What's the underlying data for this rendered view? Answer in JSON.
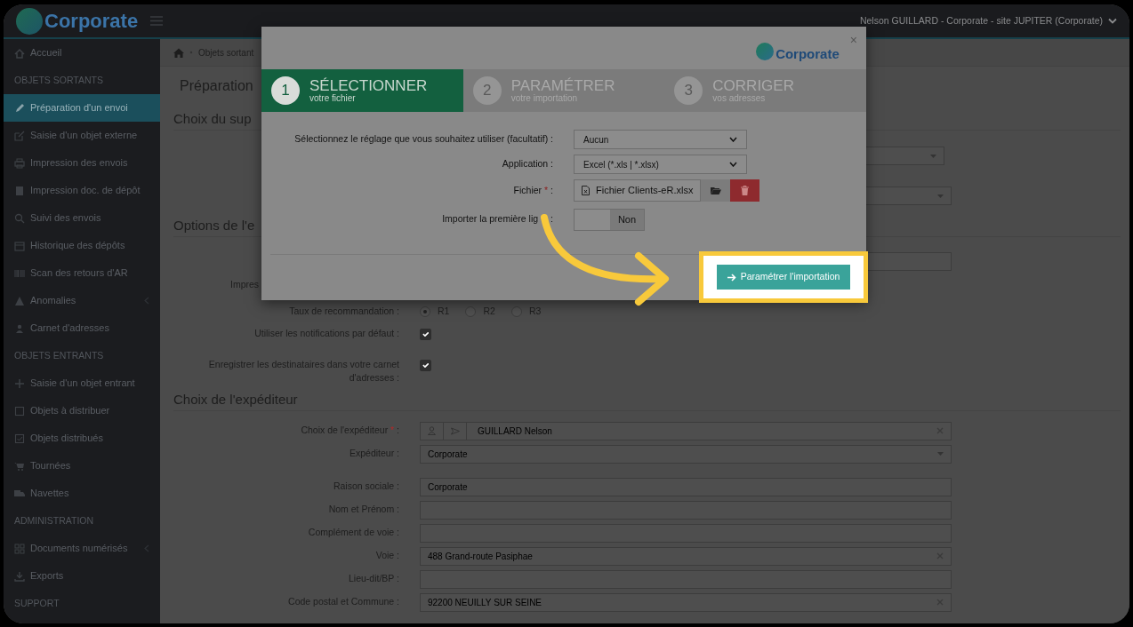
{
  "navbar": {
    "brand": "Corporate",
    "user": "Nelson GUILLARD - Corporate - site JUPITER (Corporate)"
  },
  "sidebar": {
    "items": [
      {
        "kind": "link",
        "label": "Accueil",
        "selected": false,
        "expandable": false
      },
      {
        "kind": "section",
        "label": "OBJETS SORTANTS"
      },
      {
        "kind": "link",
        "label": "Préparation d'un envoi",
        "selected": true,
        "expandable": false
      },
      {
        "kind": "link",
        "label": "Saisie d'un objet externe",
        "selected": false,
        "expandable": false
      },
      {
        "kind": "link",
        "label": "Impression des envois",
        "selected": false,
        "expandable": false
      },
      {
        "kind": "link",
        "label": "Impression doc. de dépôt",
        "selected": false,
        "expandable": false
      },
      {
        "kind": "link",
        "label": "Suivi des envois",
        "selected": false,
        "expandable": false
      },
      {
        "kind": "link",
        "label": "Historique des dépôts",
        "selected": false,
        "expandable": false
      },
      {
        "kind": "link",
        "label": "Scan des retours d'AR",
        "selected": false,
        "expandable": false
      },
      {
        "kind": "link",
        "label": "Anomalies",
        "selected": false,
        "expandable": true
      },
      {
        "kind": "link",
        "label": "Carnet d'adresses",
        "selected": false,
        "expandable": false
      },
      {
        "kind": "section",
        "label": "OBJETS ENTRANTS"
      },
      {
        "kind": "link",
        "label": "Saisie d'un objet entrant",
        "selected": false,
        "expandable": false
      },
      {
        "kind": "link",
        "label": "Objets à distribuer",
        "selected": false,
        "expandable": false
      },
      {
        "kind": "link",
        "label": "Objets distribués",
        "selected": false,
        "expandable": false
      },
      {
        "kind": "link",
        "label": "Tournées",
        "selected": false,
        "expandable": false
      },
      {
        "kind": "link",
        "label": "Navettes",
        "selected": false,
        "expandable": false
      },
      {
        "kind": "section",
        "label": "ADMINISTRATION"
      },
      {
        "kind": "link",
        "label": "Documents numérisés",
        "selected": false,
        "expandable": true
      },
      {
        "kind": "link",
        "label": "Exports",
        "selected": false,
        "expandable": false
      },
      {
        "kind": "section",
        "label": "SUPPORT"
      }
    ]
  },
  "main": {
    "breadcrumb": "Objets sortant",
    "page_title": "Préparation",
    "support_heading": "Choix du sup",
    "options_heading": "Options de l'e",
    "options_label": "Impres",
    "recommendation": {
      "label": "Taux de recommandation :",
      "options": [
        {
          "label": "R1",
          "selected": true
        },
        {
          "label": "R2",
          "selected": false
        },
        {
          "label": "R3",
          "selected": false
        }
      ]
    },
    "checks": [
      {
        "label": "Utiliser les notifications par défaut :",
        "checked": true
      },
      {
        "label": "Enregistrer les destinataires dans votre carnet d'adresses :",
        "checked": true
      }
    ],
    "sender": {
      "heading": "Choix de l'expéditeur",
      "fields": [
        {
          "kind": "picker",
          "label": "Choix de l'expéditeur",
          "required_mark": "*",
          "label_end": ":",
          "value": "GUILLARD Nelson",
          "clearable": true
        },
        {
          "kind": "select",
          "label": "Expéditeur :",
          "value": "Corporate"
        }
      ],
      "address_fields": [
        {
          "kind": "text",
          "label": "Raison sociale :",
          "value": "Corporate",
          "clearable": false
        },
        {
          "kind": "text",
          "label": "Nom et Prénom :",
          "clearable": false
        },
        {
          "kind": "text",
          "label": "Complément de voie :",
          "clearable": false
        },
        {
          "kind": "text",
          "label": "Voie :",
          "value": "488 Grand-route Pasiphae",
          "clearable": true
        },
        {
          "kind": "text",
          "label": "Lieu-dit/BP :",
          "clearable": false
        },
        {
          "kind": "text",
          "label": "Code postal et Commune :",
          "value": "92200 NEUILLY SUR SEINE",
          "clearable": true
        }
      ]
    }
  },
  "modal": {
    "logo": "Corporate",
    "close": "×",
    "steps": [
      {
        "number": "1",
        "title": "SÉLECTIONNER",
        "subtitle": "votre fichier",
        "selected": true
      },
      {
        "number": "2",
        "title": "PARAMÉTRER",
        "subtitle": "votre importation",
        "selected": false
      },
      {
        "number": "3",
        "title": "CORRIGER",
        "subtitle": "vos adresses",
        "selected": false
      }
    ],
    "preset": {
      "label": "Sélectionnez le réglage que vous souhaitez utiliser (facultatif) :",
      "value": "Aucun"
    },
    "application": {
      "label": "Application :",
      "value": "Excel (*.xls | *.xlsx)"
    },
    "file": {
      "label": "Fichier",
      "required_mark": "*",
      "label_end": ":",
      "value": "Fichier Clients-eR.xlsx"
    },
    "first_line": {
      "label": "Importer la première lig",
      "label_end": ":",
      "on": false,
      "value": "Non"
    },
    "submit": {
      "label": "Paramétrer l'importation",
      "highlighted": true
    }
  }
}
